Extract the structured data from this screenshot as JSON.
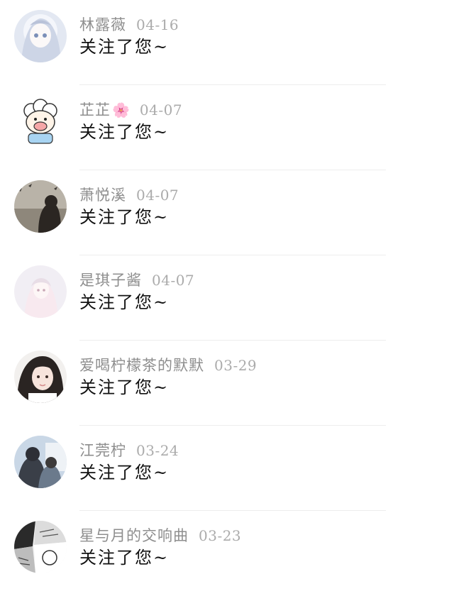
{
  "notifications": [
    {
      "name": "林露薇",
      "date": "04-16",
      "action": "关注了您~",
      "avatar_icon": "anime-girl-icon"
    },
    {
      "name": "芷芷",
      "emoji": "🌸",
      "date": "04-07",
      "action": "关注了您~",
      "avatar_icon": "cartoon-sheep-icon"
    },
    {
      "name": "萧悦溪",
      "date": "04-07",
      "action": "关注了您~",
      "avatar_icon": "girl-silhouette-icon"
    },
    {
      "name": "是琪子酱",
      "date": "04-07",
      "action": "关注了您~",
      "avatar_icon": "pastel-girl-icon"
    },
    {
      "name": "爱喝柠檬茶的默默",
      "date": "03-29",
      "action": "关注了您~",
      "avatar_icon": "selfie-girl-icon"
    },
    {
      "name": "江莞柠",
      "date": "03-24",
      "action": "关注了您~",
      "avatar_icon": "two-people-icon"
    },
    {
      "name": "星与月的交响曲",
      "date": "03-23",
      "action": "关注了您~",
      "avatar_icon": "manga-collage-icon"
    }
  ],
  "colors": {
    "name_text": "#8e8e8e",
    "date_text": "#ababab",
    "action_text": "#111111",
    "divider": "#ededed",
    "background": "#ffffff"
  }
}
